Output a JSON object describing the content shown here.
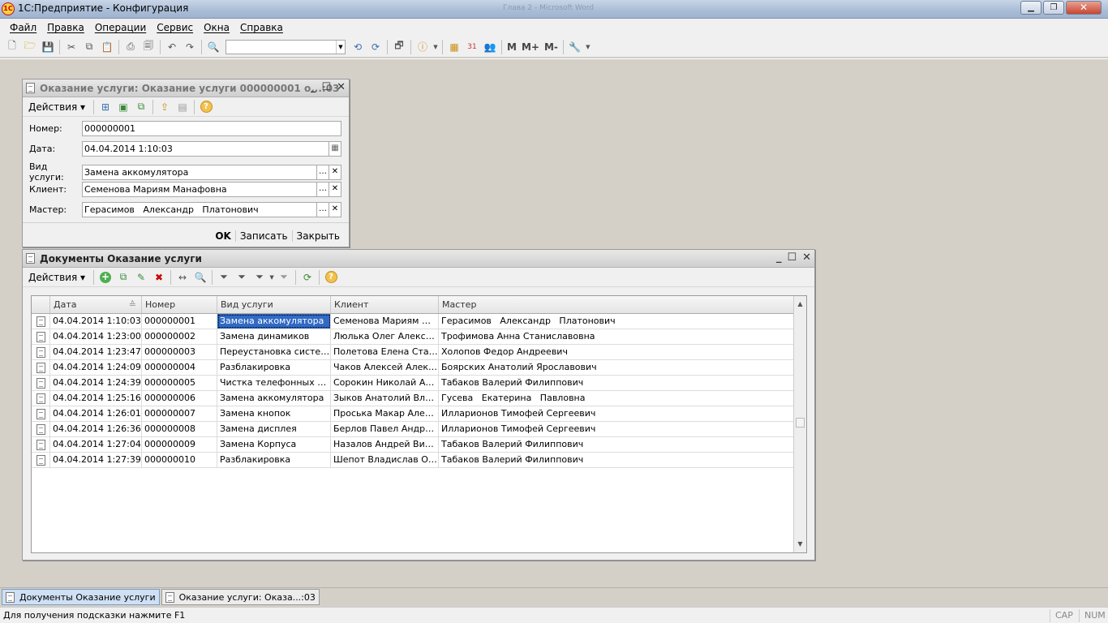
{
  "app": {
    "title": "1С:Предприятие - Конфигурация",
    "ghost_title": "Глава 2 - Microsoft Word"
  },
  "menu": [
    "Файл",
    "Правка",
    "Операции",
    "Сервис",
    "Окна",
    "Справка"
  ],
  "toolbar": {
    "m": "M",
    "mplus": "M+",
    "mminus": "M-"
  },
  "form": {
    "title": "Оказание услуги: Оказание услуги 000000001 о...:03",
    "actions": "Действия",
    "fields": [
      {
        "label": "Номер:",
        "value": "000000001"
      },
      {
        "label": "Дата:",
        "value": "04.04.2014  1:10:03"
      },
      {
        "label": "Вид услуги:",
        "value": "Замена аккомулятора"
      },
      {
        "label": "Клиент:",
        "value": "Семенова Мариям Манафовна"
      },
      {
        "label": "Мастер:",
        "value": "Герасимов   Александр   Платонович"
      }
    ],
    "buttons": {
      "ok": "OK",
      "save": "Записать",
      "close": "Закрыть"
    }
  },
  "list": {
    "title": "Документы Оказание услуги",
    "actions": "Действия",
    "columns": [
      "Дата",
      "Номер",
      "Вид услуги",
      "Клиент",
      "Мастер"
    ],
    "rows": [
      [
        "04.04.2014 1:10:03",
        "000000001",
        "Замена аккомулятора",
        "Семенова Мариям Ма...",
        "Герасимов   Александр   Платонович"
      ],
      [
        "04.04.2014 1:23:00",
        "000000002",
        "Замена динамиков",
        "Люлька Олег Алексан...",
        "Трофимова Анна Станиславовна"
      ],
      [
        "04.04.2014 1:23:47",
        "000000003",
        "Переустановка системы",
        "Полетова Елена Стан...",
        "Холопов Федор Андреевич"
      ],
      [
        "04.04.2014 1:24:09",
        "000000004",
        "Разблакировка",
        "Чаков Алексей Алекс...",
        "Боярских Анатолий Ярославович"
      ],
      [
        "04.04.2014 1:24:39",
        "000000005",
        "Чистка телефонных ко...",
        "Сорокин Николай Ана...",
        "Табаков Валерий Филиппович"
      ],
      [
        "04.04.2014 1:25:16",
        "000000006",
        "Замена аккомулятора",
        "Зыков Анатолий Влад...",
        "Гусева   Екатерина   Павловна"
      ],
      [
        "04.04.2014 1:26:01",
        "000000007",
        "Замена кнопок",
        "Проська Макар Алекс...",
        "Илларионов Тимофей Сергеевич"
      ],
      [
        "04.04.2014 1:26:36",
        "000000008",
        "Замена дисплея",
        "Берлов Павел Андрее...",
        "Илларионов Тимофей Сергеевич"
      ],
      [
        "04.04.2014 1:27:04",
        "000000009",
        "Замена Корпуса",
        "Назалов Андрей Викт...",
        "Табаков Валерий Филиппович"
      ],
      [
        "04.04.2014 1:27:39",
        "000000010",
        "Разблакировка",
        "Шепот Владислав Оле...",
        "Табаков Валерий Филиппович"
      ]
    ]
  },
  "taskbar": [
    "Документы Оказание услуги",
    "Оказание услуги: Оказа...:03"
  ],
  "status": {
    "hint": "Для получения подсказки нажмите F1",
    "cap": "CAP",
    "num": "NUM"
  },
  "colors": {
    "selection": "#316ac5",
    "workspace": "#d4d0c8"
  }
}
